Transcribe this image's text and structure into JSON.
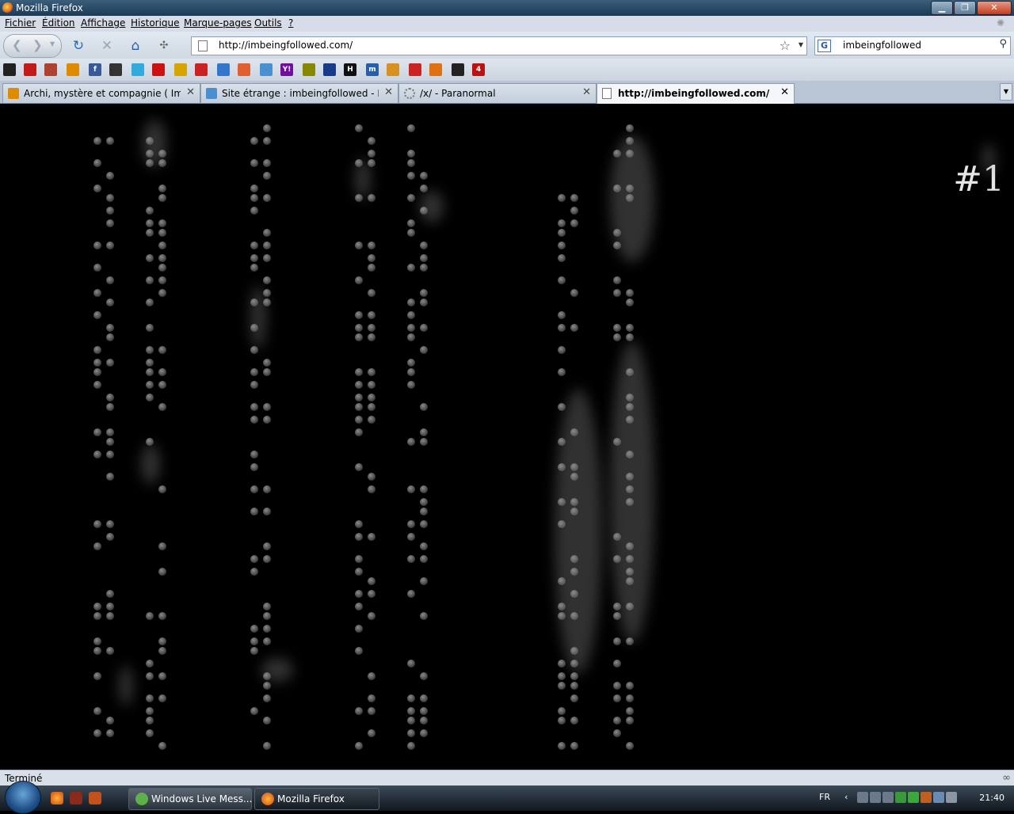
{
  "window": {
    "title": "Mozilla Firefox"
  },
  "menu": [
    "Fichier",
    "Édition",
    "Affichage",
    "Historique",
    "Marque-pages",
    "Outils",
    "?"
  ],
  "navbar": {
    "url": "http://imbeingfollowed.com/",
    "search_value": "imbeingfollowed",
    "search_engine": "G"
  },
  "bookmarks": [
    {
      "name": "bookmark-1",
      "color": "#222222",
      "glyph": ""
    },
    {
      "name": "bookmark-2",
      "color": "#c41a1a",
      "glyph": ""
    },
    {
      "name": "bookmark-3",
      "color": "#b04030",
      "glyph": ""
    },
    {
      "name": "bookmark-4",
      "color": "#e08a00",
      "glyph": ""
    },
    {
      "name": "facebook",
      "color": "#3b5998",
      "glyph": "f"
    },
    {
      "name": "bookmark-6",
      "color": "#333333",
      "glyph": ""
    },
    {
      "name": "twitter",
      "color": "#33aadd",
      "glyph": ""
    },
    {
      "name": "youtube",
      "color": "#cc1111",
      "glyph": ""
    },
    {
      "name": "bookmark-9",
      "color": "#d8a400",
      "glyph": ""
    },
    {
      "name": "bookmark-10",
      "color": "#cc2222",
      "glyph": ""
    },
    {
      "name": "bookmark-11",
      "color": "#3377cc",
      "glyph": ""
    },
    {
      "name": "bookmark-12",
      "color": "#e06030",
      "glyph": ""
    },
    {
      "name": "bookmark-13",
      "color": "#4a8fd0",
      "glyph": ""
    },
    {
      "name": "yahoo",
      "color": "#720e9e",
      "glyph": "Y!"
    },
    {
      "name": "bookmark-15",
      "color": "#888800",
      "glyph": ""
    },
    {
      "name": "bookmark-16",
      "color": "#1a3a8a",
      "glyph": ""
    },
    {
      "name": "bookmark-17",
      "color": "#111111",
      "glyph": "H"
    },
    {
      "name": "bookmark-18",
      "color": "#2a5fa8",
      "glyph": "m"
    },
    {
      "name": "bookmark-19",
      "color": "#d89020",
      "glyph": ""
    },
    {
      "name": "bookmark-20",
      "color": "#cc2222",
      "glyph": ""
    },
    {
      "name": "bookmark-21",
      "color": "#e07010",
      "glyph": ""
    },
    {
      "name": "bookmark-22",
      "color": "#222222",
      "glyph": ""
    },
    {
      "name": "bookmark-23",
      "color": "#bb1111",
      "glyph": "4"
    }
  ],
  "tabs": [
    {
      "label": "Archi, mystère et compagnie ( Imbe...",
      "active": false
    },
    {
      "label": "Site étrange : imbeingfollowed - Bla...",
      "active": false
    },
    {
      "label": "/x/ - Paranormal",
      "active": false
    },
    {
      "label": "http://imbeingfollowed.com/",
      "active": true
    }
  ],
  "page": {
    "number_label": "#1"
  },
  "status": {
    "text": "Terminé"
  },
  "taskbar": {
    "buttons": [
      {
        "label": "Windows Live Mess...",
        "active": false
      },
      {
        "label": "Mozilla Firefox",
        "active": true
      }
    ],
    "lang": "FR",
    "clock": "21:40"
  }
}
